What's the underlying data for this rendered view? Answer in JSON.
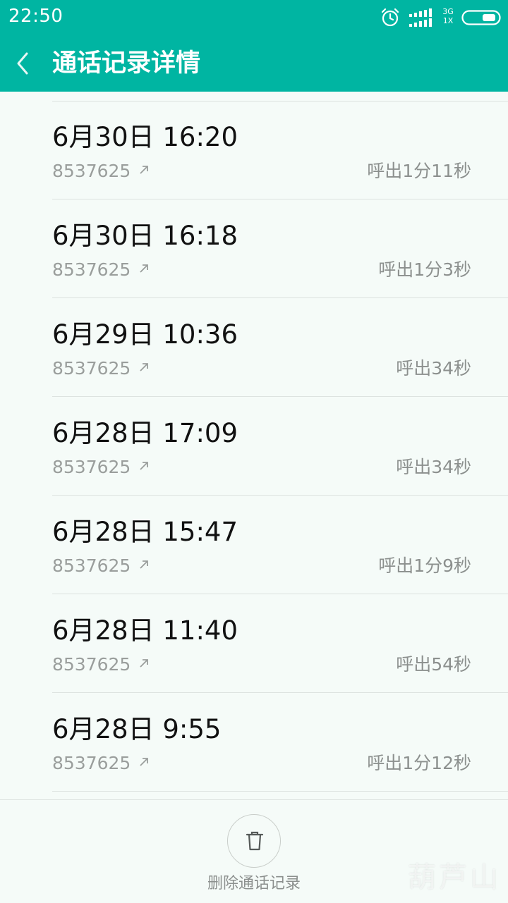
{
  "status_bar": {
    "time": "22:50",
    "network_top": "3G",
    "network_bottom": "1X",
    "icons": [
      "alarm-icon",
      "signal-icon",
      "battery-icon"
    ]
  },
  "header": {
    "title": "通话记录详情",
    "back_icon": "chevron-left-icon"
  },
  "calls": [
    {
      "datetime": "6月30日 16:20",
      "number": "8537625",
      "duration": "呼出1分11秒"
    },
    {
      "datetime": "6月30日 16:18",
      "number": "8537625",
      "duration": "呼出1分3秒"
    },
    {
      "datetime": "6月29日 10:36",
      "number": "8537625",
      "duration": "呼出34秒"
    },
    {
      "datetime": "6月28日 17:09",
      "number": "8537625",
      "duration": "呼出34秒"
    },
    {
      "datetime": "6月28日 15:47",
      "number": "8537625",
      "duration": "呼出1分9秒"
    },
    {
      "datetime": "6月28日 11:40",
      "number": "8537625",
      "duration": "呼出54秒"
    },
    {
      "datetime": "6月28日 9:55",
      "number": "8537625",
      "duration": "呼出1分12秒"
    }
  ],
  "footer": {
    "delete_label": "删除通话记录",
    "delete_icon": "trash-icon"
  },
  "watermark": "葫芦山",
  "colors": {
    "accent": "#00b5a2",
    "background": "#f5fbf8",
    "primary_text": "#111111",
    "secondary_text": "#9a9e9c"
  }
}
